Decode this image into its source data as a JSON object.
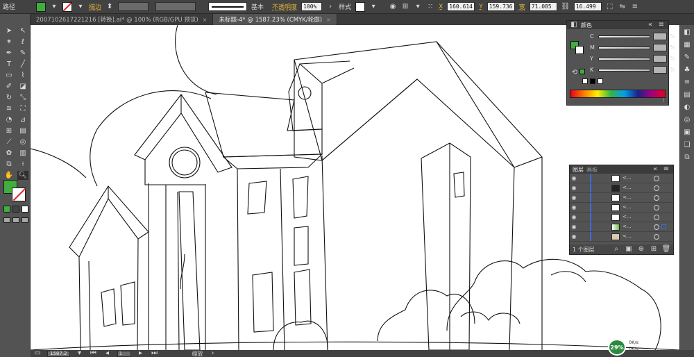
{
  "control_bar": {
    "path_label": "路径",
    "stroke_label": "描边",
    "stroke_profile": "基本",
    "opacity_label": "不透明度",
    "opacity_value": "100%",
    "style_label": "样式",
    "x_value": "160.614",
    "y_value": "159.736",
    "w_label": "宽",
    "w_value": "71.085",
    "h_value": "16.499",
    "unit_pct": "%",
    "fill_color": "#3fae3c",
    "x_label": "X",
    "y_label": "Y"
  },
  "tabs": [
    {
      "label": "2007102617221216 [转换].ai* @ 100% (RGB/GPU 预览)",
      "close": "×"
    },
    {
      "label": "未标题-4* @ 1587.23% (CMYK/轮廓)",
      "close": "×"
    }
  ],
  "toolbox": {
    "fill_color": "#3fae3c",
    "stroke_color": "#ffffff",
    "tools": [
      "selection-tool",
      "direct-selection-tool",
      "magic-wand-tool",
      "lasso-tool",
      "pen-tool",
      "curvature-tool",
      "type-tool",
      "line-tool",
      "rectangle-tool",
      "paintbrush-tool",
      "shaper-tool",
      "eraser-tool",
      "rotate-tool",
      "scale-tool",
      "width-tool",
      "free-transform-tool",
      "shape-builder-tool",
      "perspective-tool",
      "mesh-tool",
      "gradient-tool",
      "eyedropper-tool",
      "blend-tool",
      "symbol-sprayer-tool",
      "column-graph-tool",
      "artboard-tool",
      "slice-tool",
      "hand-tool",
      "zoom-tool"
    ],
    "selected_tool": "zoom-tool"
  },
  "color_panel": {
    "title": "颜色",
    "channels": [
      {
        "key": "C",
        "value": ""
      },
      {
        "key": "M",
        "value": ""
      },
      {
        "key": "Y",
        "value": ""
      },
      {
        "key": "K",
        "value": ""
      }
    ],
    "pct": "%",
    "fill_color": "#3fae3c"
  },
  "layers_panel": {
    "tab_layers": "图层",
    "tab_artboards": "画板",
    "rows": [
      {
        "name": "<...",
        "thumb": "line"
      },
      {
        "name": "<...",
        "thumb": "black-shape"
      },
      {
        "name": "<...",
        "thumb": "white"
      },
      {
        "name": "<...",
        "thumb": "white"
      },
      {
        "name": "<...",
        "thumb": "white"
      },
      {
        "name": "<...",
        "thumb": "green",
        "selected": true
      },
      {
        "name": "<...",
        "thumb": "white"
      }
    ],
    "footer_count": "1 个图层"
  },
  "status_bar": {
    "zoom": "1587.2",
    "page": "1",
    "tool_name": "缩放"
  },
  "net_widget": {
    "percent": "29%",
    "up": "0K/s",
    "down": "0K/s"
  }
}
